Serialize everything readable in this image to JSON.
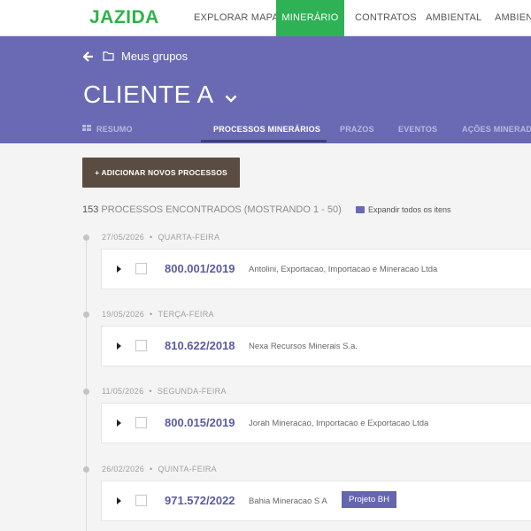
{
  "app": {
    "logo": "JAZIDA",
    "nav": [
      {
        "label": "EXPLORAR MAPA",
        "active": false
      },
      {
        "label": "MINERÁRIO",
        "active": true
      },
      {
        "label": "CONTRATOS",
        "active": false
      },
      {
        "label": "AMBIENTAL",
        "active": false
      },
      {
        "label": "AMBIENT",
        "active": false
      }
    ]
  },
  "header": {
    "back_label": "Meus grupos",
    "client": "CLIENTE A",
    "tabs": [
      {
        "label": "RESUMO",
        "active": false
      },
      {
        "label": "PROCESSOS MINERÁRIOS",
        "active": true
      },
      {
        "label": "PRAZOS",
        "active": false
      },
      {
        "label": "EVENTOS",
        "active": false
      },
      {
        "label": "AÇÕES MINERADO",
        "active": false
      }
    ]
  },
  "main": {
    "add_button": "+ ADICIONAR NOVOS PROCESSOS",
    "summary_count": "153",
    "summary_text": " PROCESSOS ENCONTRADOS (MOSTRANDO 1 - 50)",
    "expand_label": "Expandir todos os itens",
    "entries": [
      {
        "date": "27/05/2026",
        "weekday": "QUARTA-FEIRA",
        "number": "800.001/2019",
        "company": "Antolini, Exportacao, Importacao e Mineracao Ltda",
        "tag": ""
      },
      {
        "date": "19/05/2026",
        "weekday": "TERÇA-FEIRA",
        "number": "810.622/2018",
        "company": "Nexa Recursos Minerais S.a.",
        "tag": ""
      },
      {
        "date": "11/05/2026",
        "weekday": "SEGUNDA-FEIRA",
        "number": "800.015/2019",
        "company": "Jorah Mineracao, Importacao e Exportacao Ltda",
        "tag": ""
      },
      {
        "date": "26/02/2026",
        "weekday": "QUINTA-FEIRA",
        "number": "971.572/2022",
        "company": "Bahia Mineracao S A",
        "tag": "Projeto BH"
      }
    ]
  },
  "colors": {
    "brand_green": "#2fb156",
    "header_purple": "#6a6ab4",
    "button_brown": "#5b4c42",
    "link_purple": "#5b5ba5"
  }
}
